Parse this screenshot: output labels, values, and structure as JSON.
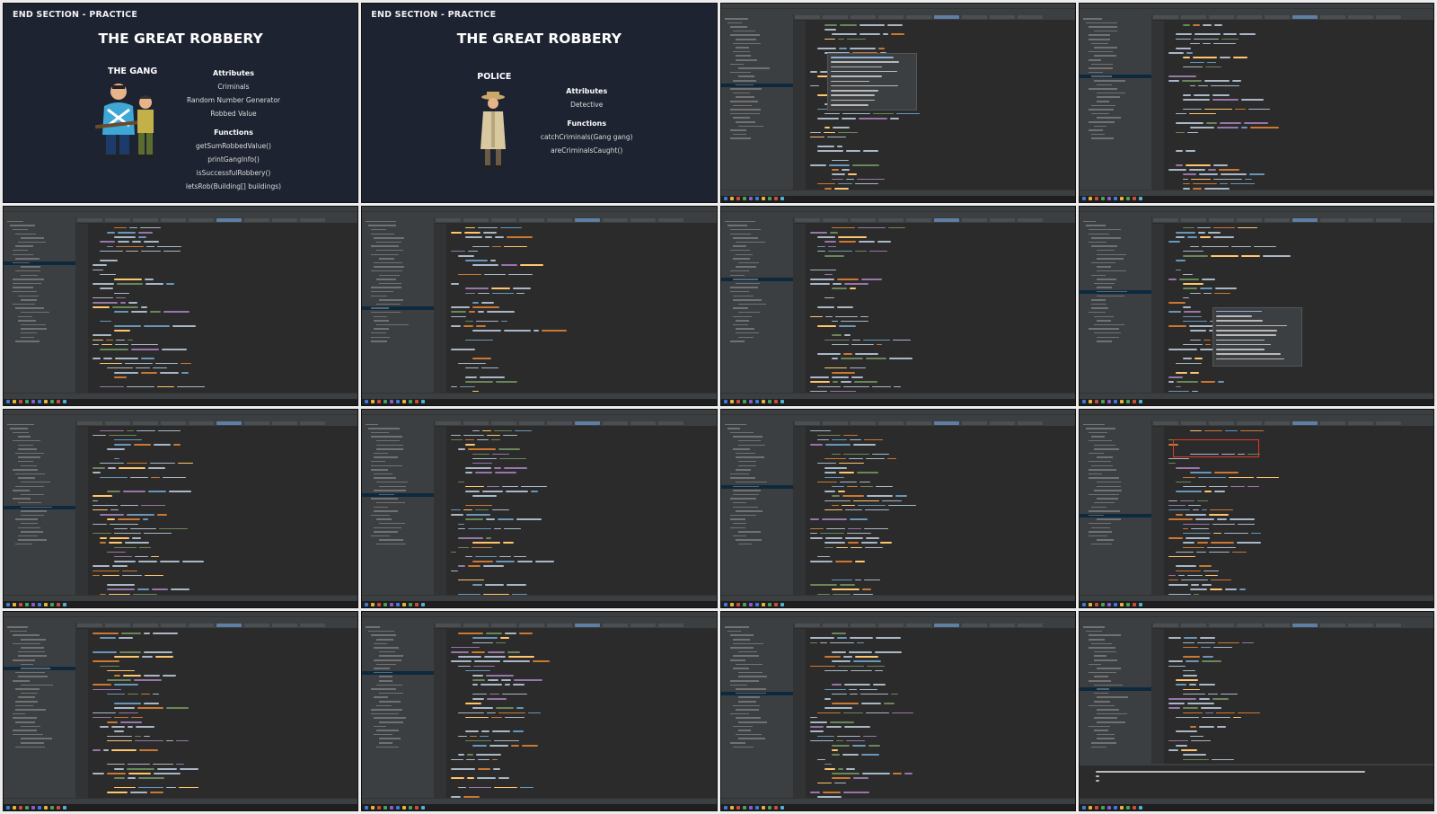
{
  "slide_gang": {
    "section": "END SECTION - PRACTICE",
    "title": "THE GREAT ROBBERY",
    "group": "THE GANG",
    "attributes_heading": "Attributes",
    "attributes": [
      "Criminals",
      "Random Number Generator",
      "Robbed Value"
    ],
    "functions_heading": "Functions",
    "functions": [
      "getSumRobbedValue()",
      "printGangInfo()",
      "isSuccessfulRobbery()",
      "letsRob(Building[] buildings)"
    ]
  },
  "slide_police": {
    "section": "END SECTION - PRACTICE",
    "title": "THE GREAT ROBBERY",
    "group": "POLICE",
    "attributes_heading": "Attributes",
    "attributes": [
      "Detective"
    ],
    "functions_heading": "Functions",
    "functions": [
      "catchCriminals(Gang gang)",
      "areCriminalsCaught()"
    ]
  },
  "colors": {
    "slide_bg": "#1d2331",
    "ide_bg": "#2b2b2b",
    "ide_panel": "#3c3f41",
    "keyword": "#cc7832",
    "string": "#6a8759",
    "number": "#6897bb",
    "field": "#9876aa",
    "plain": "#a9b7c6",
    "method": "#ffc66d",
    "highlight_box": "#e0392b"
  },
  "ide_cells": [
    {
      "popup": true
    },
    {
      "popup": false
    },
    {
      "popup": false
    },
    {
      "popup": false
    },
    {
      "popup": false
    },
    {
      "popup": true
    },
    {
      "popup": false
    },
    {
      "popup": false
    },
    {
      "popup": false
    },
    {
      "highlight": true
    },
    {
      "popup": false
    },
    {
      "popup": false
    },
    {
      "popup": false
    },
    {
      "terminal": true
    }
  ]
}
